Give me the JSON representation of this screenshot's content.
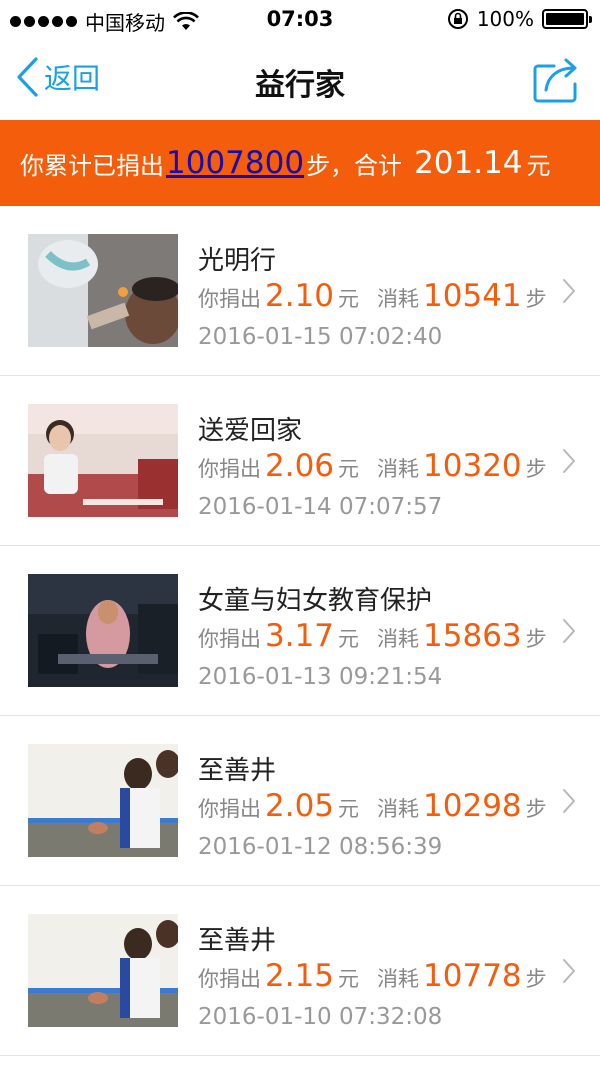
{
  "status_bar": {
    "carrier": "中国移动",
    "time": "07:03",
    "battery": "100%"
  },
  "nav": {
    "back_label": "返回",
    "title": "益行家"
  },
  "summary": {
    "prefix": "你累计已捐出",
    "steps": "1007800",
    "mid": "步，合计",
    "amount": "201.14",
    "suffix": "元"
  },
  "labels": {
    "donated": "你捐出",
    "yuan": "元",
    "consumed": "消耗",
    "steps_unit": "步"
  },
  "items": [
    {
      "title": "光明行",
      "amount": "2.10",
      "steps": "10541",
      "date": "2016-01-15 07:02:40"
    },
    {
      "title": "送爱回家",
      "amount": "2.06",
      "steps": "10320",
      "date": "2016-01-14 07:07:57"
    },
    {
      "title": "女童与妇女教育保护",
      "amount": "3.17",
      "steps": "15863",
      "date": "2016-01-13 09:21:54"
    },
    {
      "title": "至善井",
      "amount": "2.05",
      "steps": "10298",
      "date": "2016-01-12 08:56:39"
    },
    {
      "title": "至善井",
      "amount": "2.15",
      "steps": "10778",
      "date": "2016-01-10 07:32:08"
    }
  ],
  "colors": {
    "accent": "#f45d0c",
    "link_blue": "#1aa0e6"
  }
}
